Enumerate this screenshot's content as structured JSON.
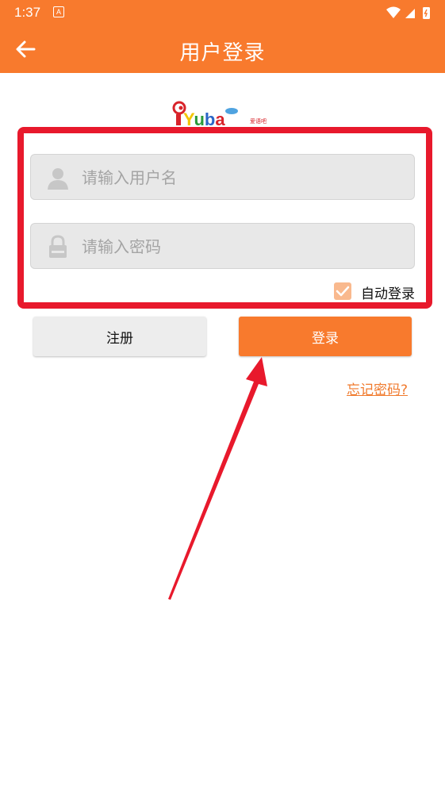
{
  "status_bar": {
    "time": "1:37",
    "notification_letter": "A"
  },
  "app_bar": {
    "title": "用户登录",
    "back_icon": "arrow-left-icon"
  },
  "logo": {
    "text": "iYuba",
    "tagline": "爱语吧"
  },
  "form": {
    "username_placeholder": "请输入用户名",
    "password_placeholder": "请输入密码",
    "auto_login_label": "自动登录",
    "auto_login_checked": true
  },
  "buttons": {
    "register": "注册",
    "login": "登录"
  },
  "forgot_password": "忘记密码?",
  "colors": {
    "primary": "#F87A2D",
    "highlight": "#E8192C",
    "field_bg": "#E8E8E8"
  }
}
